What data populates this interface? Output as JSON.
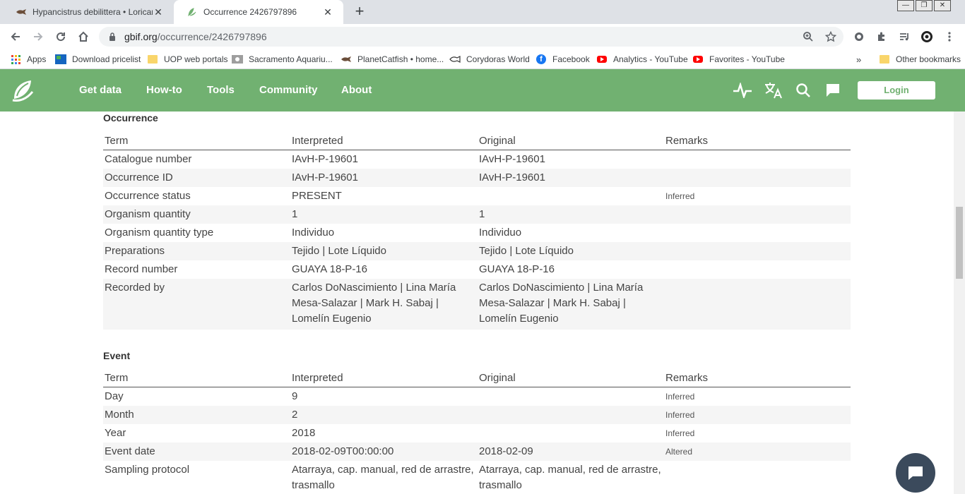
{
  "browser": {
    "tabs": [
      {
        "title": "Hypancistrus debilittera • Loricariidae",
        "active": false
      },
      {
        "title": "Occurrence 2426797896",
        "active": true
      }
    ],
    "url_host": "gbif.org",
    "url_path": "/occurrence/2426797896"
  },
  "bookmarks": [
    {
      "label": "Apps",
      "icon": "apps-grid-icon"
    },
    {
      "label": "Download pricelist",
      "icon": "site-icon"
    },
    {
      "label": "UOP web portals",
      "icon": "folder-icon"
    },
    {
      "label": "Sacramento Aquariu...",
      "icon": "site-icon"
    },
    {
      "label": "PlanetCatfish • home...",
      "icon": "catfish-icon"
    },
    {
      "label": "Corydoras World",
      "icon": "fish-icon"
    },
    {
      "label": "Facebook",
      "icon": "facebook-icon"
    },
    {
      "label": "Analytics - YouTube",
      "icon": "youtube-icon"
    },
    {
      "label": "Favorites - YouTube",
      "icon": "youtube-icon"
    },
    {
      "label": "Other bookmarks",
      "icon": "folder-icon"
    }
  ],
  "header": {
    "nav": [
      "Get data",
      "How-to",
      "Tools",
      "Community",
      "About"
    ],
    "login": "Login",
    "accent": "#71b171"
  },
  "occurrence": {
    "title": "Occurrence",
    "columns": [
      "Term",
      "Interpreted",
      "Original",
      "Remarks"
    ],
    "rows": [
      {
        "term": "Catalogue number",
        "interpreted": "IAvH-P-19601",
        "original": "IAvH-P-19601",
        "remarks": ""
      },
      {
        "term": "Occurrence ID",
        "interpreted": "IAvH-P-19601",
        "original": "IAvH-P-19601",
        "remarks": ""
      },
      {
        "term": "Occurrence status",
        "interpreted": "PRESENT",
        "original": "",
        "remarks": "Inferred"
      },
      {
        "term": "Organism quantity",
        "interpreted": "1",
        "original": "1",
        "remarks": ""
      },
      {
        "term": "Organism quantity type",
        "interpreted": "Individuo",
        "original": "Individuo",
        "remarks": ""
      },
      {
        "term": "Preparations",
        "interpreted": "Tejido | Lote Líquido",
        "original": "Tejido | Lote Líquido",
        "remarks": ""
      },
      {
        "term": "Record number",
        "interpreted": "GUAYA 18-P-16",
        "original": "GUAYA 18-P-16",
        "remarks": ""
      },
      {
        "term": "Recorded by",
        "interpreted": "Carlos DoNascimiento | Lina María Mesa-Salazar | Mark H. Sabaj | Lomelín Eugenio",
        "original": "Carlos DoNascimiento | Lina María Mesa-Salazar | Mark H. Sabaj | Lomelín Eugenio",
        "remarks": ""
      }
    ]
  },
  "event": {
    "title": "Event",
    "columns": [
      "Term",
      "Interpreted",
      "Original",
      "Remarks"
    ],
    "rows": [
      {
        "term": "Day",
        "interpreted": "9",
        "original": "",
        "remarks": "Inferred"
      },
      {
        "term": "Month",
        "interpreted": "2",
        "original": "",
        "remarks": "Inferred"
      },
      {
        "term": "Year",
        "interpreted": "2018",
        "original": "",
        "remarks": "Inferred"
      },
      {
        "term": "Event date",
        "interpreted": "2018-02-09T00:00:00",
        "original": "2018-02-09",
        "remarks": "Altered"
      },
      {
        "term": "Sampling protocol",
        "interpreted": "Atarraya, cap. manual, red de arrastre, trasmallo",
        "original": "Atarraya, cap. manual, red de arrastre, trasmallo",
        "remarks": ""
      }
    ]
  }
}
